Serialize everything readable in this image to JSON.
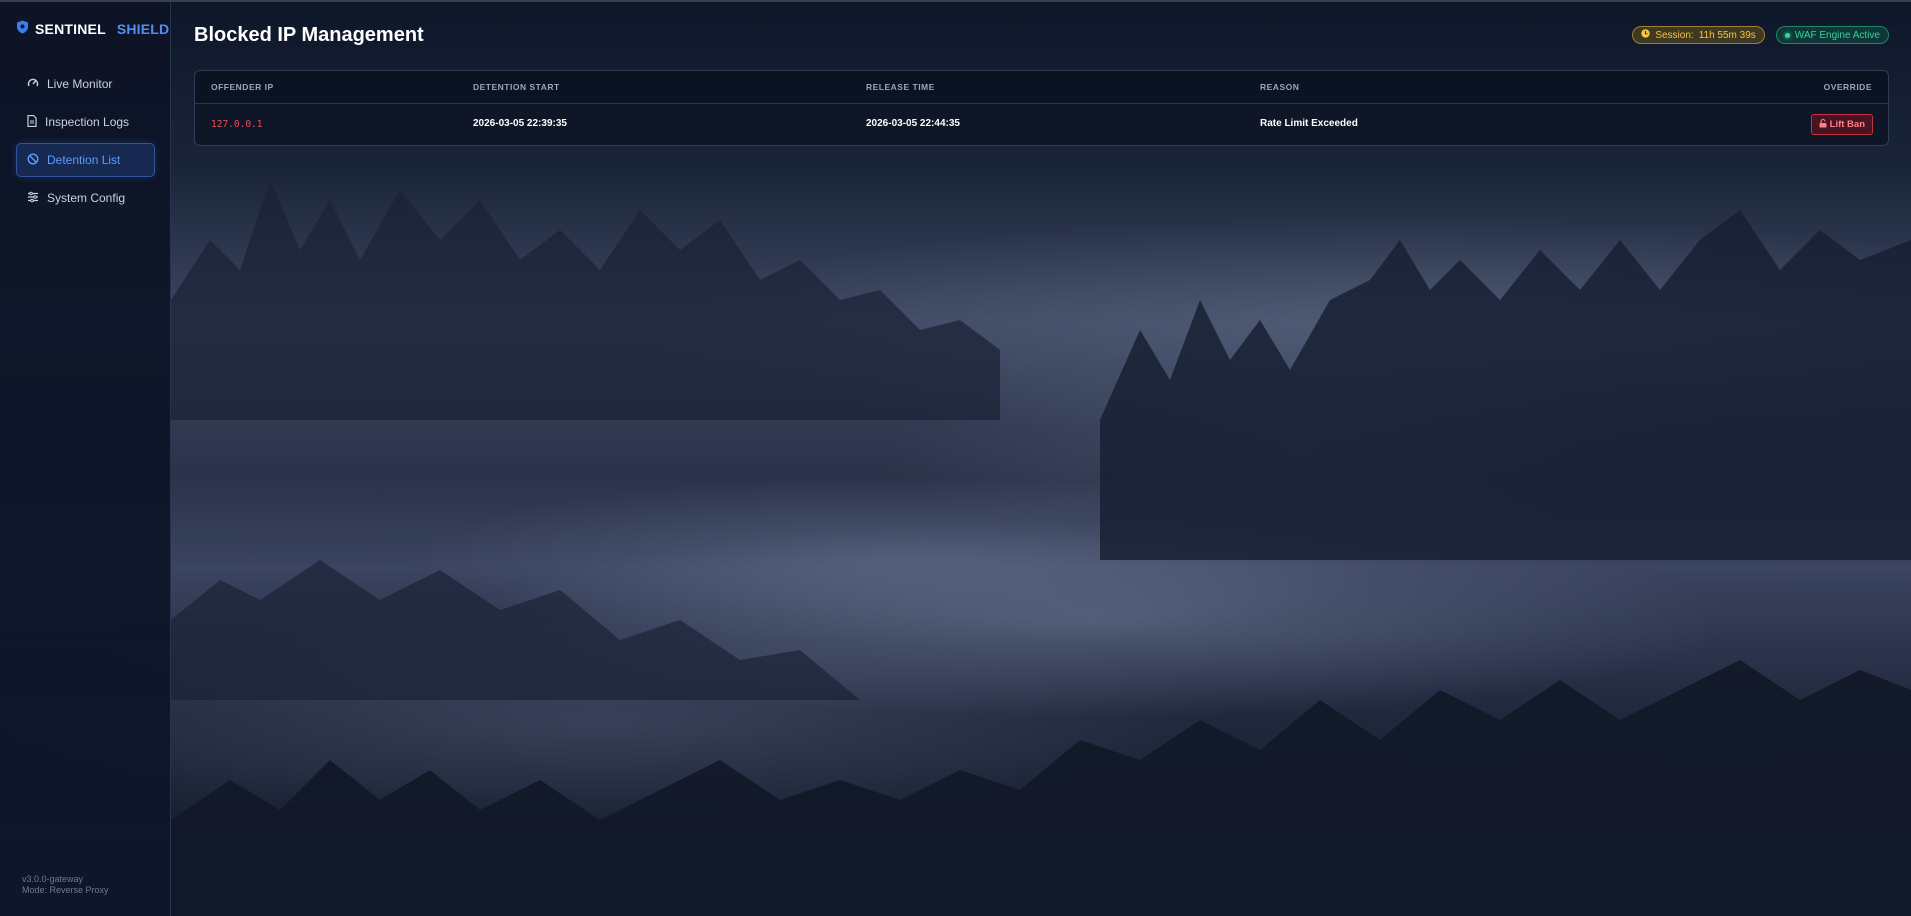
{
  "brand": {
    "word1": "SENTINEL",
    "word2": "SHIELD"
  },
  "sidebar": {
    "items": [
      {
        "label": "Live Monitor",
        "icon": "gauge-icon",
        "active": false
      },
      {
        "label": "Inspection Logs",
        "icon": "document-icon",
        "active": false
      },
      {
        "label": "Detention List",
        "icon": "ban-icon",
        "active": true
      },
      {
        "label": "System Config",
        "icon": "sliders-icon",
        "active": false
      }
    ],
    "footer": {
      "version": "v3.0.0-gateway",
      "mode": "Mode: Reverse Proxy"
    }
  },
  "header": {
    "title": "Blocked IP Management",
    "session_label": "Session:",
    "session_value": "11h 55m 39s",
    "waf_status": "WAF Engine Active"
  },
  "table": {
    "columns": [
      "OFFENDER IP",
      "DETENTION START",
      "RELEASE TIME",
      "REASON",
      "OVERRIDE"
    ],
    "rows": [
      {
        "ip": "127.0.0.1",
        "start": "2026-03-05 22:39:35",
        "release": "2026-03-05 22:44:35",
        "reason": "Rate Limit Exceeded",
        "action": "Lift Ban"
      }
    ]
  },
  "colors": {
    "accent": "#4f8df7",
    "danger": "#f04b57",
    "session": "#f5c541",
    "success": "#36d39a"
  }
}
